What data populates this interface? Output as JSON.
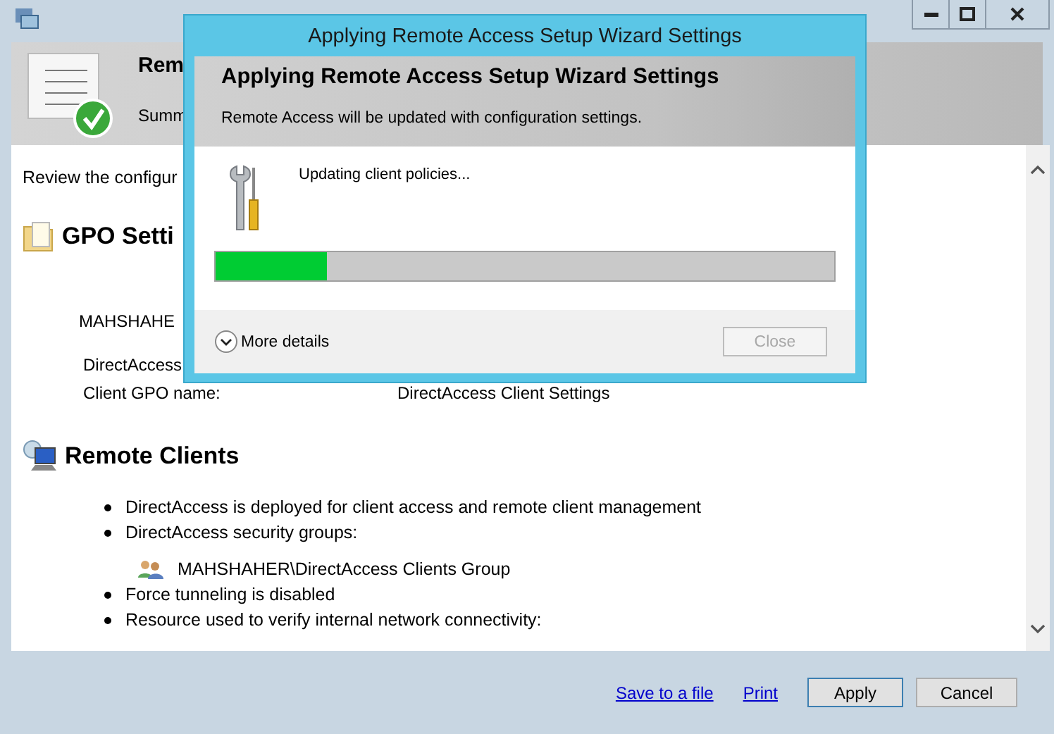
{
  "header": {
    "title": "Rem",
    "subtitle": "Summ"
  },
  "content": {
    "intro": "Review the configur",
    "gpo": {
      "heading": "GPO Setti",
      "server": "MAHSHAHE",
      "rows": [
        {
          "label": "DirectAccess"
        },
        {
          "label": "Client GPO name:",
          "value": "DirectAccess Client Settings"
        }
      ]
    },
    "remote": {
      "heading": "Remote Clients",
      "items": [
        {
          "kind": "bullet",
          "text": "DirectAccess is deployed for client access and remote client management"
        },
        {
          "kind": "bullet",
          "text": "DirectAccess security groups:"
        },
        {
          "kind": "group",
          "text": "MAHSHAHER\\DirectAccess Clients Group"
        },
        {
          "kind": "bullet",
          "text": "Force tunneling is disabled"
        },
        {
          "kind": "bullet",
          "text": "Resource used to verify internal network connectivity:"
        }
      ]
    }
  },
  "footer": {
    "links": [
      "Save to a file",
      "Print"
    ],
    "buttons": [
      "Apply",
      "Cancel"
    ]
  },
  "dialog": {
    "title": "Applying Remote Access Setup Wizard Settings",
    "heading": "Applying Remote Access Setup Wizard Settings",
    "subtitle": "Remote Access will be updated with configuration settings.",
    "status": "Updating client policies...",
    "progress": {
      "level": 0.18
    },
    "details": {
      "label": "More details",
      "expanded": false
    },
    "close": {
      "label": "Close",
      "disabled": true
    }
  }
}
